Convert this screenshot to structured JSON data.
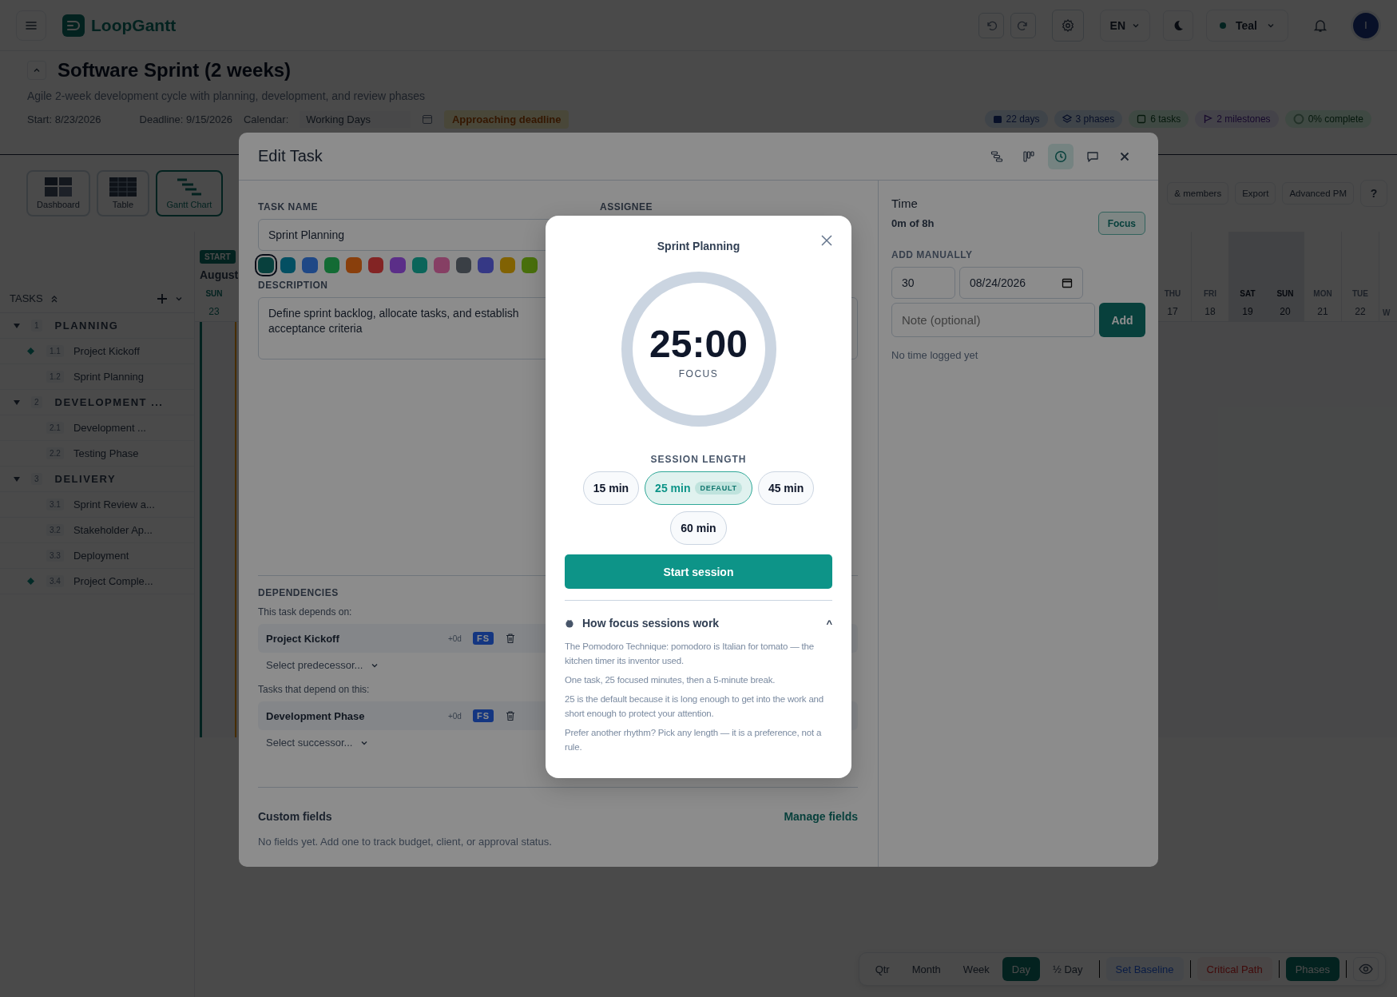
{
  "app": {
    "name": "LoopGantt",
    "language": "EN",
    "theme": "Teal",
    "avatar": "I"
  },
  "project": {
    "title": "Software Sprint (2 weeks)",
    "subtitle": "Agile 2-week development cycle with planning, development, and review phases",
    "start": "Start: 8/23/2026",
    "deadline": "Deadline: 9/15/2026",
    "calendar_label": "Calendar:",
    "calendar_value": "Working Days",
    "alert": "Approaching deadline",
    "stats": [
      {
        "kind": "days",
        "text": "22 days"
      },
      {
        "kind": "phases",
        "text": "3 phases"
      },
      {
        "kind": "tasks",
        "text": "6 tasks"
      },
      {
        "kind": "milestones",
        "text": "2 milestones"
      },
      {
        "kind": "complete",
        "text": "0% complete"
      }
    ]
  },
  "views": [
    {
      "label": "Dashboard",
      "kind": "dashboard",
      "selected": false
    },
    {
      "label": "Table",
      "kind": "table",
      "selected": false
    },
    {
      "label": "Gantt Chart",
      "kind": "gantt",
      "selected": true
    }
  ],
  "actions": [
    "& members",
    "Export",
    "Advanced PM",
    "?"
  ],
  "task_list": {
    "title": "TASKS",
    "groups": [
      {
        "number": "1",
        "name": "PLANNING",
        "expanded": true,
        "children": [
          {
            "number": "1.1",
            "name": "Project Kickoff",
            "milestone": true
          },
          {
            "number": "1.2",
            "name": "Sprint Planning",
            "milestone": false
          }
        ]
      },
      {
        "number": "2",
        "name": "DEVELOPMENT ...",
        "expanded": true,
        "children": [
          {
            "number": "2.1",
            "name": "Development ...",
            "milestone": false
          },
          {
            "number": "2.2",
            "name": "Testing Phase",
            "milestone": false
          }
        ]
      },
      {
        "number": "3",
        "name": "DELIVERY",
        "expanded": true,
        "children": [
          {
            "number": "3.1",
            "name": "Sprint Review a...",
            "milestone": false
          },
          {
            "number": "3.2",
            "name": "Stakeholder Ap...",
            "milestone": false
          },
          {
            "number": "3.3",
            "name": "Deployment",
            "milestone": false
          },
          {
            "number": "3.4",
            "name": "Project Comple...",
            "milestone": true
          }
        ]
      }
    ]
  },
  "gantt": {
    "start_badge": "START",
    "month": "August",
    "days_left": [
      {
        "day": "SUN",
        "date": "23"
      }
    ],
    "days_right": [
      {
        "day": "THU",
        "date": "17",
        "weekend": false
      },
      {
        "day": "FRI",
        "date": "18",
        "weekend": false
      },
      {
        "day": "SAT",
        "date": "19",
        "weekend": true
      },
      {
        "day": "SUN",
        "date": "20",
        "weekend": true
      },
      {
        "day": "MON",
        "date": "21",
        "weekend": false
      },
      {
        "day": "TUE",
        "date": "22",
        "weekend": false
      },
      {
        "day": "W",
        "weekend": false
      }
    ]
  },
  "zoom_bar": [
    {
      "label": "Qtr",
      "kind": "scale",
      "selected": false
    },
    {
      "label": "Month",
      "kind": "scale",
      "selected": false
    },
    {
      "label": "Week",
      "kind": "scale",
      "selected": false
    },
    {
      "label": "Day",
      "kind": "scale",
      "selected": true
    },
    {
      "label": "½ Day",
      "kind": "scale",
      "selected": false
    },
    {
      "label": "Set Baseline",
      "kind": "baseline",
      "selected": false
    },
    {
      "label": "Critical Path",
      "kind": "critical",
      "selected": false
    },
    {
      "label": "Phases",
      "kind": "phases",
      "selected": true
    }
  ],
  "edit_task": {
    "title": "Edit Task",
    "header_tabs": [
      {
        "kind": "hierarchy",
        "selected": false
      },
      {
        "kind": "board",
        "selected": false
      },
      {
        "kind": "time",
        "selected": true
      },
      {
        "kind": "comments",
        "selected": false
      }
    ],
    "task_name_label": "TASK NAME",
    "task_name": "Sprint Planning",
    "assignee_label": "ASSIGNEE",
    "colors": [
      {
        "color": "#08413d",
        "selected": true
      },
      {
        "color": "#045062",
        "selected": false
      },
      {
        "color": "#204887",
        "selected": false
      },
      {
        "color": "#136c34",
        "selected": false
      },
      {
        "color": "#893f0c",
        "selected": false
      },
      {
        "color": "#832525",
        "selected": false
      },
      {
        "color": "#5c2f88",
        "selected": false
      },
      {
        "color": "#0b655b",
        "selected": false
      },
      {
        "color": "#863f64",
        "selected": false
      },
      {
        "color": "#3b3f46",
        "selected": false
      },
      {
        "color": "#363885",
        "selected": false
      },
      {
        "color": "#816204",
        "selected": false
      },
      {
        "color": "#49700c",
        "selected": false
      }
    ],
    "description_label": "DESCRIPTION",
    "description": "Define sprint backlog, allocate tasks, and establish acceptance criteria",
    "dependencies": {
      "title": "DEPENDENCIES",
      "predecessors_label": "This task depends on:",
      "predecessors": [
        {
          "name": "Project Kickoff",
          "lag": "+0d",
          "type": "FS"
        }
      ],
      "predecessor_placeholder": "Select predecessor...",
      "successors_label": "Tasks that depend on this:",
      "successors": [
        {
          "name": "Development Phase",
          "lag": "+0d",
          "type": "FS"
        }
      ],
      "successor_placeholder": "Select successor..."
    },
    "custom_fields": {
      "title": "Custom fields",
      "manage": "Manage fields",
      "empty": "No fields yet. Add one to track budget, client, or approval status."
    },
    "time": {
      "title": "Time",
      "logged": "0m of 8h",
      "focus_button": "Focus",
      "add_label": "ADD MANUALLY",
      "minutes": "30",
      "date": "08/24/2026",
      "note_placeholder": "Note (optional)",
      "add_button": "Add",
      "empty": "No time logged yet"
    }
  },
  "focus": {
    "task": "Sprint Planning",
    "timer": "25:00",
    "mode": "FOCUS",
    "length_label": "SESSION LENGTH",
    "lengths": [
      {
        "label": "15 min",
        "selected": false
      },
      {
        "label": "25 min",
        "selected": true,
        "badge": "DEFAULT"
      },
      {
        "label": "45 min",
        "selected": false
      },
      {
        "label": "60 min",
        "selected": false
      }
    ],
    "start": "Start session",
    "info_title": "How focus sessions work",
    "info_expanded": true,
    "info_toggle": "^",
    "info": [
      "The Pomodoro Technique: pomodoro is Italian for tomato — the kitchen timer its inventor used.",
      "One task, 25 focused minutes, then a 5-minute break.",
      "25 is the default because it is long enough to get into the work and short enough to protect your attention.",
      "Prefer another rhythm? Pick any length — it is a preference, not a rule."
    ]
  }
}
